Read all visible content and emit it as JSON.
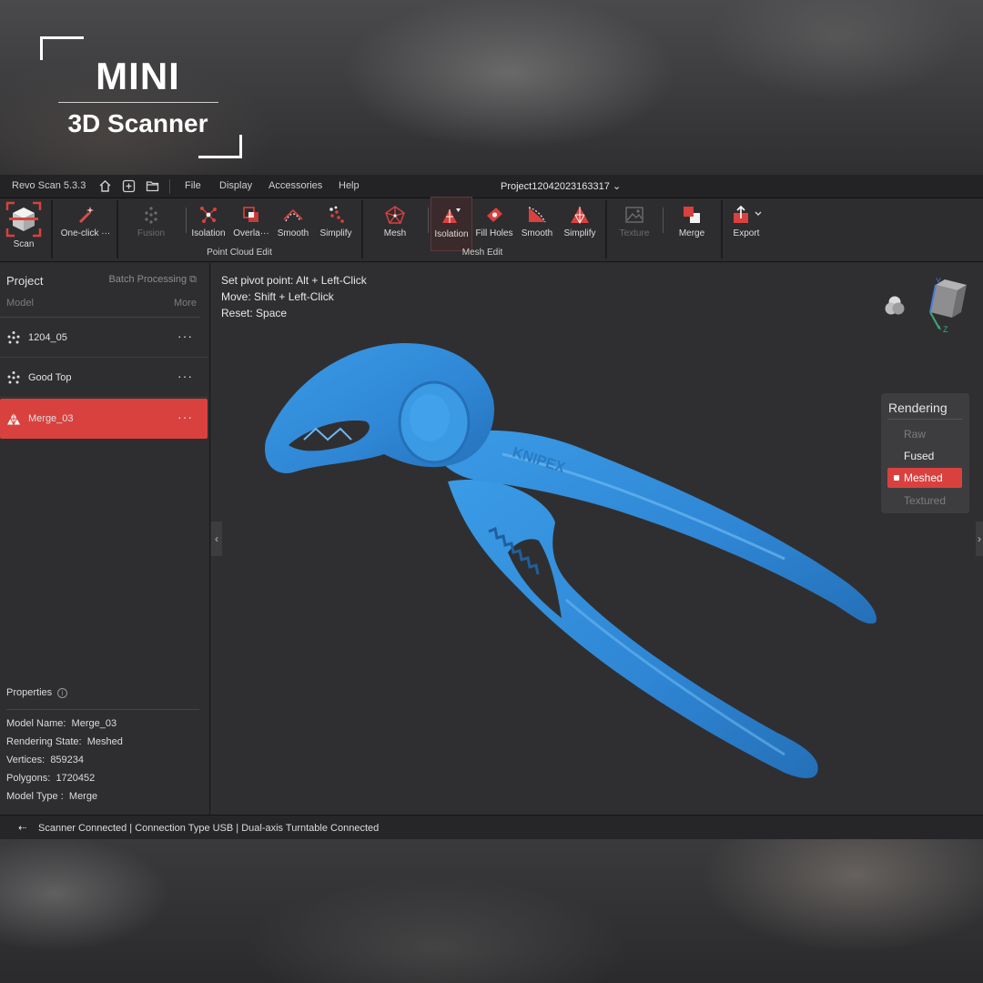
{
  "brand": {
    "title": "MINI",
    "subtitle": "3D Scanner"
  },
  "menubar": {
    "version": "Revo Scan 5.3.3",
    "icons": [
      "home-icon",
      "add-icon",
      "folder-icon"
    ],
    "menus": [
      "File",
      "Display",
      "Accessories",
      "Help"
    ],
    "project": "Project12042023163317"
  },
  "toolbar": {
    "scan": "Scan",
    "oneclick": "One-click ···",
    "point_cloud": {
      "label": "Point Cloud Edit",
      "fusion": "Fusion",
      "isolation": "Isolation",
      "overlap": "Overla···",
      "smooth": "Smooth",
      "simplify": "Simplify"
    },
    "mesh_edit": {
      "label": "Mesh Edit",
      "mesh": "Mesh",
      "isolation": "Isolation",
      "fill_holes": "Fill Holes",
      "smooth": "Smooth",
      "simplify": "Simplify"
    },
    "texture": "Texture",
    "merge": "Merge",
    "export": "Export"
  },
  "left_panel": {
    "project": "Project",
    "batch": "Batch Processing",
    "model_header": "Model",
    "more": "More",
    "models": [
      {
        "name": "1204_05",
        "dots": "···",
        "type": "point-cloud"
      },
      {
        "name": "Good Top",
        "dots": "···",
        "type": "point-cloud"
      },
      {
        "name": "Merge_03",
        "dots": "···",
        "type": "mesh",
        "selected": true
      }
    ],
    "properties_title": "Properties",
    "properties": [
      {
        "label": "Model Name:",
        "value": "Merge_03"
      },
      {
        "label": "Rendering State:",
        "value": "Meshed"
      },
      {
        "label": "Vertices:",
        "value": "859234"
      },
      {
        "label": "Polygons:",
        "value": "1720452"
      },
      {
        "label": "Model Type :",
        "value": "Merge"
      }
    ]
  },
  "viewport": {
    "hints": [
      {
        "label": "Set pivot point:",
        "key": "Alt + Left-Click"
      },
      {
        "label": "Move:",
        "key": "Shift + Left-Click"
      },
      {
        "label": "Reset:",
        "key": "Space"
      }
    ],
    "axis_labels": {
      "y": "Y",
      "z": "Z"
    },
    "rendering": {
      "title": "Rendering",
      "options": [
        "Raw",
        "Fused",
        "Meshed",
        "Textured"
      ],
      "selected": "Meshed"
    },
    "model_color": "#2f86d4"
  },
  "status": {
    "text": "Scanner Connected | Connection Type USB  | Dual-axis Turntable Connected"
  },
  "colors": {
    "accent": "#d9413e",
    "mesh": "#2f86d4"
  }
}
